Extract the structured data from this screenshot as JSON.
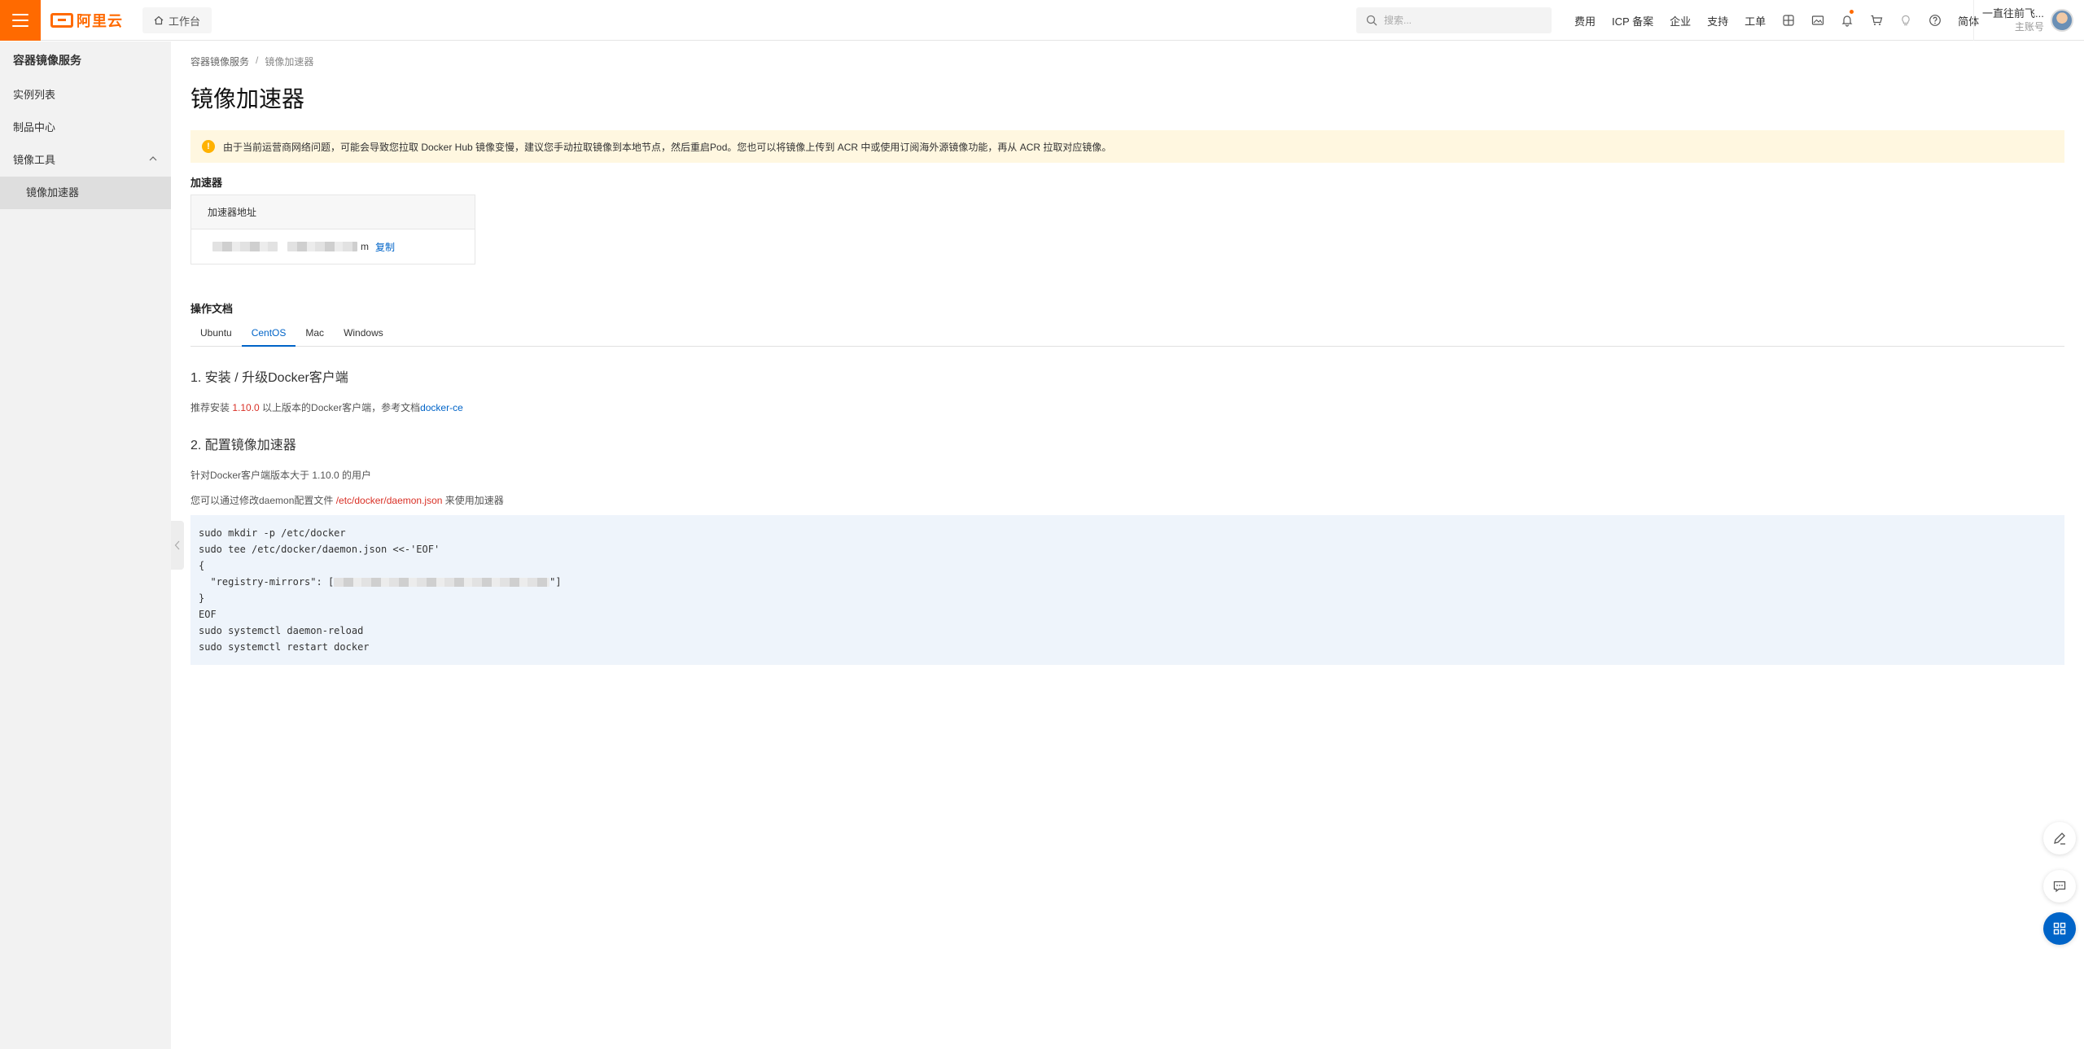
{
  "topbar": {
    "logo_text": "阿里云",
    "workbench_label": "工作台",
    "search_placeholder": "搜索...",
    "nav": [
      "费用",
      "ICP 备案",
      "企业",
      "支持",
      "工单"
    ],
    "lang_label": "简体",
    "user_name": "一直往前飞...",
    "user_role": "主账号"
  },
  "sidebar": {
    "title": "容器镜像服务",
    "items": [
      "实例列表",
      "制品中心",
      "镜像工具"
    ],
    "subitem_active": "镜像加速器"
  },
  "main": {
    "breadcrumb": [
      "容器镜像服务",
      "镜像加速器"
    ],
    "breadcrumb_sep": "/",
    "title": "镜像加速器",
    "alert": "由于当前运营商网络问题，可能会导致您拉取 Docker Hub 镜像变慢，建议您手动拉取镜像到本地节点，然后重启Pod。您也可以将镜像上传到 ACR 中或使用订阅海外源镜像功能，再从 ACR 拉取对应镜像。",
    "accel_section": "加速器",
    "accel_table_header": "加速器地址",
    "accel_address_suffix": "m",
    "copy_label": "复制",
    "docs_section": "操作文档",
    "tabs": [
      "Ubuntu",
      "CentOS",
      "Mac",
      "Windows"
    ],
    "active_tab": "CentOS",
    "step1_title": "1. 安装 / 升级Docker客户端",
    "step1_text_a": "推荐安装 ",
    "step1_version": "1.10.0",
    "step1_text_b": " 以上版本的Docker客户端，参考文档",
    "step1_link": "docker-ce",
    "step2_title": "2. 配置镜像加速器",
    "step2_text1": "针对Docker客户端版本大于 1.10.0 的用户",
    "step2_text2_a": "您可以通过修改daemon配置文件 ",
    "step2_path": "/etc/docker/daemon.json",
    "step2_text2_b": " 来使用加速器",
    "code": {
      "l1": "sudo mkdir -p /etc/docker",
      "l2": "sudo tee /etc/docker/daemon.json <<-'EOF'",
      "l3": "{",
      "l4_prefix": "  \"registry-mirrors\": [",
      "l4_suffix": "\"]",
      "l5": "}",
      "l6": "EOF",
      "l7": "sudo systemctl daemon-reload",
      "l8": "sudo systemctl restart docker"
    }
  }
}
